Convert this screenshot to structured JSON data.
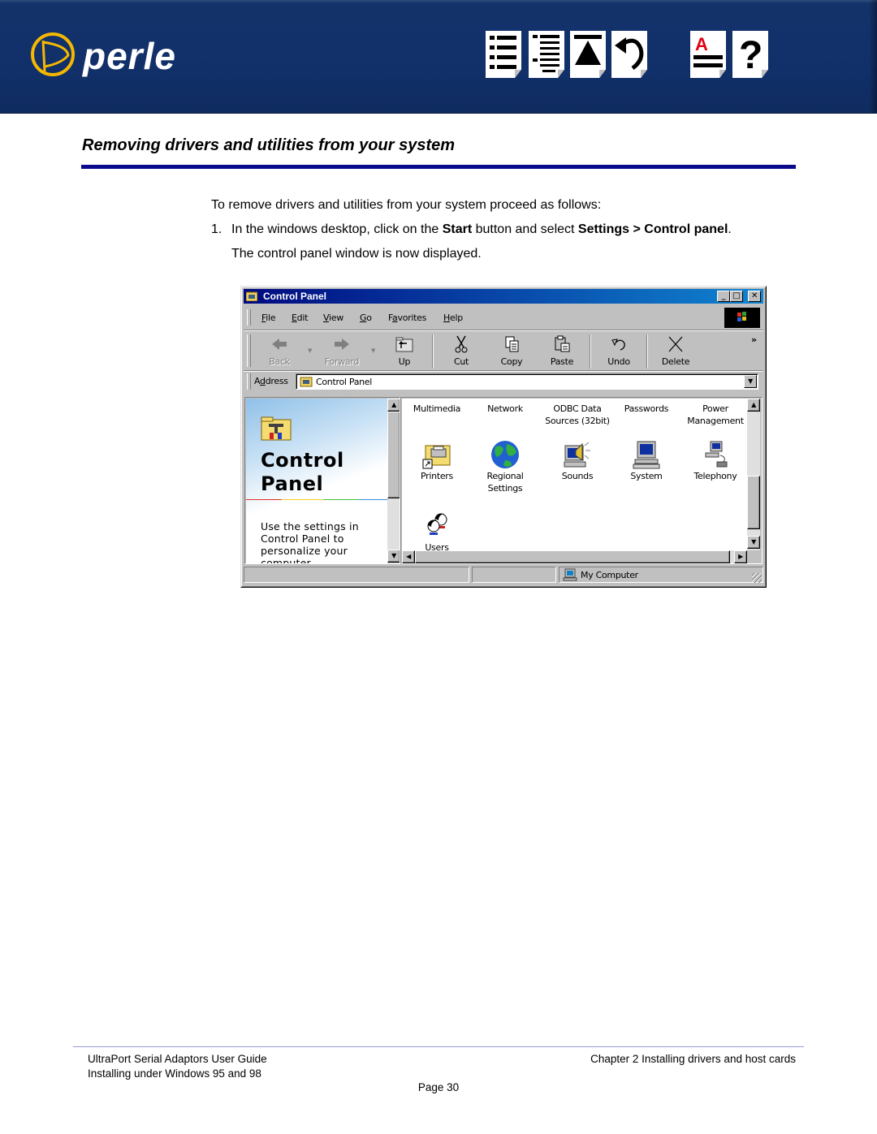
{
  "header": {
    "brand": "perle",
    "nav_icons": [
      {
        "name": "contents-icon"
      },
      {
        "name": "index-icon"
      },
      {
        "name": "top-of-section-icon"
      },
      {
        "name": "back-icon"
      },
      {
        "name": "glossary-icon"
      },
      {
        "name": "help-icon"
      }
    ],
    "brand_color": "#11306a",
    "logo_accent": "#f5b800"
  },
  "section": {
    "title": "Removing drivers and utilities from your system",
    "rule_color": "#0a0a8c"
  },
  "body": {
    "intro": "To remove drivers and utilities from your system proceed as follows:",
    "step1": {
      "number": "1.",
      "t1": "In the windows desktop, click on the ",
      "b1": "Start",
      "t2": " button and select ",
      "b2": "Settings > Control panel",
      "t3": "."
    },
    "step1_cont": "The control panel window is now displayed."
  },
  "window": {
    "title": "Control Panel",
    "caption_buttons": {
      "minimize": "_",
      "maximize": "□",
      "close": "✕"
    },
    "menu": [
      {
        "pre": "",
        "u": "F",
        "post": "ile"
      },
      {
        "pre": "",
        "u": "E",
        "post": "dit"
      },
      {
        "pre": "",
        "u": "V",
        "post": "iew"
      },
      {
        "pre": "",
        "u": "G",
        "post": "o"
      },
      {
        "pre": "F",
        "u": "a",
        "post": "vorites"
      },
      {
        "pre": "",
        "u": "H",
        "post": "elp"
      }
    ],
    "toolbar": [
      {
        "label": "Back",
        "icon": "back-arrow-icon",
        "enabled": false
      },
      {
        "label": "Forward",
        "icon": "forward-arrow-icon",
        "enabled": false
      },
      {
        "label": "Up",
        "icon": "up-folder-icon",
        "enabled": true
      },
      {
        "label": "Cut",
        "icon": "scissors-icon",
        "enabled": true
      },
      {
        "label": "Copy",
        "icon": "copy-icon",
        "enabled": true
      },
      {
        "label": "Paste",
        "icon": "paste-icon",
        "enabled": true
      },
      {
        "label": "Undo",
        "icon": "undo-icon",
        "enabled": true
      },
      {
        "label": "Delete",
        "icon": "delete-icon",
        "enabled": true
      }
    ],
    "toolbar_overflow": "»",
    "address": {
      "label_pre": "A",
      "label_u": "d",
      "label_post": "dress",
      "value": "Control Panel"
    },
    "info_pane": {
      "title_line1": "Control",
      "title_line2": "Panel",
      "description": "Use the settings in Control Panel to personalize your computer."
    },
    "items": [
      {
        "label": "Multimedia"
      },
      {
        "label": "Network"
      },
      {
        "label": "ODBC Data\nSources (32bit)"
      },
      {
        "label": "Passwords"
      },
      {
        "label": "Power\nManagement"
      },
      {
        "label": "Printers",
        "icon": "printers-folder-icon"
      },
      {
        "label": "Regional\nSettings",
        "icon": "globe-icon"
      },
      {
        "label": "Sounds",
        "icon": "speaker-computer-icon"
      },
      {
        "label": "System",
        "icon": "computer-icon"
      },
      {
        "label": "Telephony",
        "icon": "telephony-icon"
      },
      {
        "label": "Users",
        "icon": "users-icon"
      }
    ],
    "status": {
      "zone": "My Computer"
    },
    "colors": {
      "titlebar_start": "#000a80",
      "titlebar_end": "#1084d0",
      "face": "#c0c0c0"
    }
  },
  "footer": {
    "guide": "UltraPort Serial Adaptors User Guide",
    "section": "Installing under Windows 95 and 98",
    "chapter": "Chapter 2 Installing drivers and host cards",
    "page": "Page 30"
  }
}
